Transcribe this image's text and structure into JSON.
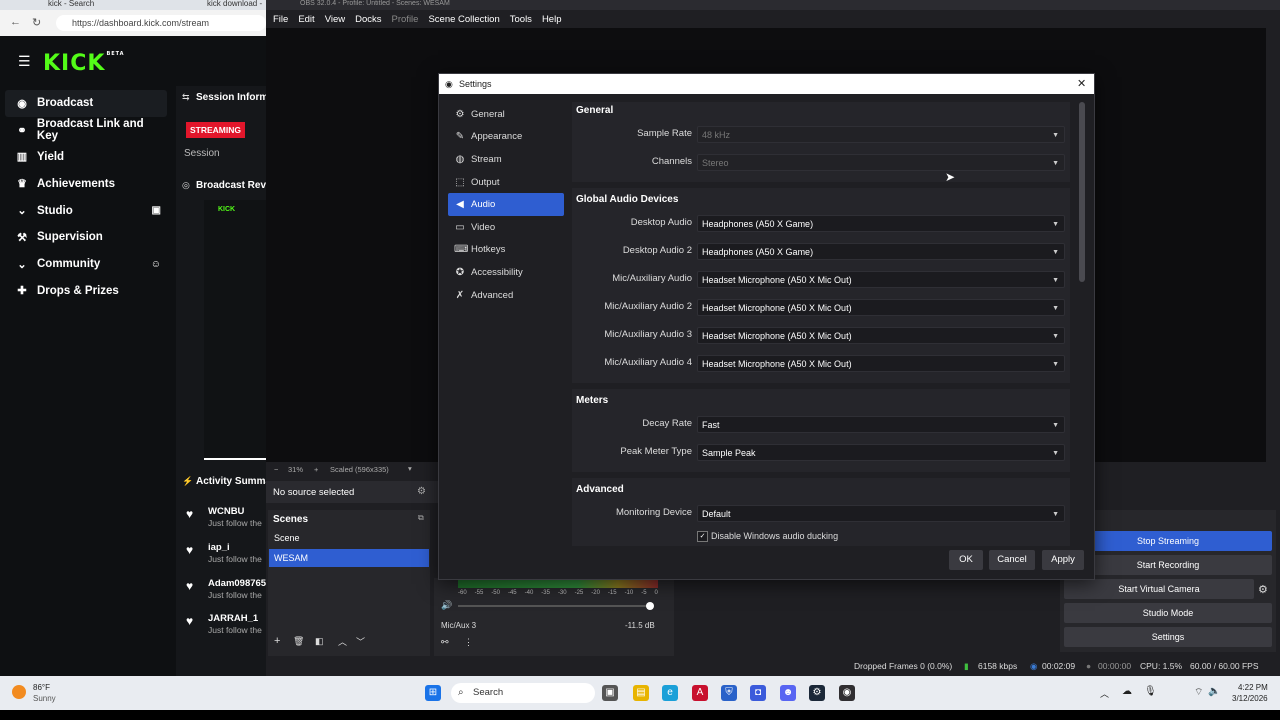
{
  "browser": {
    "tabs": [
      "kick - Search",
      "kick download -"
    ],
    "url": "https://dashboard.kick.com/stream"
  },
  "kick": {
    "logo": "KICK",
    "logo_badge": "BETA",
    "nav": [
      {
        "label": "Broadcast",
        "icon": "broadcast-icon"
      },
      {
        "label": "Broadcast Link and Key",
        "icon": "link-icon"
      },
      {
        "label": "Yield",
        "icon": "chart-icon"
      },
      {
        "label": "Achievements",
        "icon": "trophy-icon"
      },
      {
        "label": "Studio",
        "icon": "chevron-down-icon"
      },
      {
        "label": "Supervision",
        "icon": "hammer-icon"
      },
      {
        "label": "Community",
        "icon": "chevron-down-icon"
      },
      {
        "label": "Drops & Prizes",
        "icon": "gift-icon"
      }
    ],
    "session_title": "Session Informa",
    "streaming_badge": "STREAMING",
    "session_label": "Session",
    "broadcast_preview_title": "Broadcast Revie",
    "activity_title": "Activity Summa",
    "activity": [
      {
        "name": "WCNBU",
        "sub": "Just follow the"
      },
      {
        "name": "iap_i",
        "sub": "Just follow the"
      },
      {
        "name": "Adam098765",
        "sub": "Just follow the"
      },
      {
        "name": "JARRAH_1",
        "sub": "Just follow the"
      }
    ]
  },
  "obs": {
    "title": "OBS 32.0.4 - Profile: Untitled - Scenes: WESAM",
    "menu": [
      "File",
      "Edit",
      "View",
      "Docks",
      "Profile",
      "Scene Collection",
      "Tools",
      "Help"
    ],
    "zoom": "31%",
    "scaled": "Scaled (596x335)",
    "no_source": "No source selected",
    "scenes_title": "Scenes",
    "scenes": [
      "Scene",
      "WESAM"
    ],
    "mixer_label": "Mic/Aux 3",
    "mixer_db": "-11.5 dB",
    "mixer_ticks": [
      "-60",
      "-55",
      "-50",
      "-45",
      "-40",
      "-35",
      "-30",
      "-25",
      "-20",
      "-15",
      "-10",
      "-5",
      "0"
    ],
    "controls": [
      "Stop Streaming",
      "Start Recording",
      "Start Virtual Camera",
      "Studio Mode",
      "Settings"
    ],
    "status": {
      "dropped": "Dropped Frames 0 (0.0%)",
      "bitrate": "6158 kbps",
      "stream_time": "00:02:09",
      "rec_time": "00:00:00",
      "cpu": "CPU: 1.5%",
      "fps": "60.00 / 60.00 FPS"
    }
  },
  "settings": {
    "title": "Settings",
    "nav": [
      {
        "label": "General",
        "icon": "gear-icon"
      },
      {
        "label": "Appearance",
        "icon": "brush-icon"
      },
      {
        "label": "Stream",
        "icon": "globe-icon"
      },
      {
        "label": "Output",
        "icon": "output-icon"
      },
      {
        "label": "Audio",
        "icon": "speaker-icon"
      },
      {
        "label": "Video",
        "icon": "monitor-icon"
      },
      {
        "label": "Hotkeys",
        "icon": "keyboard-icon"
      },
      {
        "label": "Accessibility",
        "icon": "accessibility-icon"
      },
      {
        "label": "Advanced",
        "icon": "wrench-icon"
      }
    ],
    "sections": {
      "general": "General",
      "global_devices": "Global Audio Devices",
      "meters": "Meters",
      "advanced": "Advanced"
    },
    "general_rows": [
      {
        "label": "Sample Rate",
        "value": "48 kHz"
      },
      {
        "label": "Channels",
        "value": "Stereo"
      }
    ],
    "device_rows": [
      {
        "label": "Desktop Audio",
        "value": "Headphones (A50 X Game)"
      },
      {
        "label": "Desktop Audio 2",
        "value": "Headphones (A50 X Game)"
      },
      {
        "label": "Mic/Auxiliary Audio",
        "value": "Headset Microphone (A50 X Mic Out)"
      },
      {
        "label": "Mic/Auxiliary Audio 2",
        "value": "Headset Microphone (A50 X Mic Out)"
      },
      {
        "label": "Mic/Auxiliary Audio 3",
        "value": "Headset Microphone (A50 X Mic Out)"
      },
      {
        "label": "Mic/Auxiliary Audio 4",
        "value": "Headset Microphone (A50 X Mic Out)"
      }
    ],
    "meter_rows": [
      {
        "label": "Decay Rate",
        "value": "Fast"
      },
      {
        "label": "Peak Meter Type",
        "value": "Sample Peak"
      }
    ],
    "advanced_rows": [
      {
        "label": "Monitoring Device",
        "value": "Default"
      }
    ],
    "ducking_label": "Disable Windows audio ducking",
    "ducking_checked": true,
    "buttons": {
      "ok": "OK",
      "cancel": "Cancel",
      "apply": "Apply"
    }
  },
  "taskbar": {
    "weather_temp": "86°F",
    "weather_desc": "Sunny",
    "search": "Search",
    "time": "4:22 PM",
    "date": "3/12/2026"
  },
  "colors": {
    "kick_green": "#53fc18",
    "accent_blue": "#2f5ed1",
    "streaming_red": "#e2162b"
  }
}
